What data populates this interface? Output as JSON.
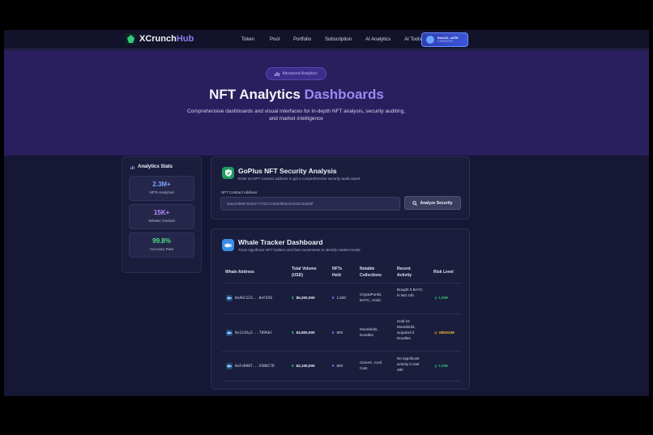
{
  "nav": {
    "brand_main": "XCrunch",
    "brand_accent": "Hub",
    "links": [
      "Token",
      "Pool",
      "Portfolio",
      "Subscription",
      "AI Analytics",
      "AI Tools"
    ],
    "wallet_address": "0xec12...a7Df",
    "wallet_balance": "0.0000 ETH"
  },
  "hero": {
    "badge": "Advanced Analytics",
    "title_main": "NFT Analytics",
    "title_accent": "Dashboards",
    "subtitle": "Comprehensive dashboards and visual interfaces for in-depth NFT analysis, security auditing, and market intelligence"
  },
  "stats": {
    "title": "Analytics Stats",
    "items": [
      {
        "value": "2.3M+",
        "label": "NFTs Analyzed",
        "color": "#7fa2ff"
      },
      {
        "value": "15K+",
        "label": "Whales Tracked",
        "color": "#b58cff"
      },
      {
        "value": "99.8%",
        "label": "Accuracy Rate",
        "color": "#4fe08a"
      }
    ]
  },
  "security": {
    "title": "GoPlus NFT Security Analysis",
    "description": "Enter an NFT contract address to get a comprehensive security audit report",
    "input_label": "NFT Contract Address",
    "input_value": "0xee24b8672022c7770CCC828d656224418C8a005f",
    "button_label": "Analyze Security"
  },
  "whale": {
    "title": "Whale Tracker Dashboard",
    "description": "Track significant NFT holders and their movements to identify market trends",
    "headers": [
      "Whale Address",
      "Total Volume (USD)",
      "NFTs Held",
      "Notable Collections",
      "Recent Activity",
      "Risk Level"
    ],
    "rows": [
      {
        "address": "0xAbC123...0eF456",
        "volume": "$5,200,000",
        "nfts": "1,500",
        "collections": "CryptoPunks, BAYC, Azuki",
        "activity": "Bought 5 BAYC in last 24h",
        "risk": "LOW",
        "risk_color": "#2fd07a"
      },
      {
        "address": "0x123XyZ...789AbC",
        "volume": "$3,800,000",
        "nfts": "800",
        "collections": "Moonbirds, Doodles",
        "activity": "Sold 10 Moonbirds, acquired 2 Doodles",
        "risk": "MEDIUM",
        "risk_color": "#f0b92a"
      },
      {
        "address": "0xFeD987...A5B6C7D",
        "volume": "$2,100,000",
        "nfts": "600",
        "collections": "CloneX, Cool Cats",
        "activity": "No significant activity in last 48h",
        "risk": "LOW",
        "risk_color": "#2fd07a"
      }
    ]
  }
}
